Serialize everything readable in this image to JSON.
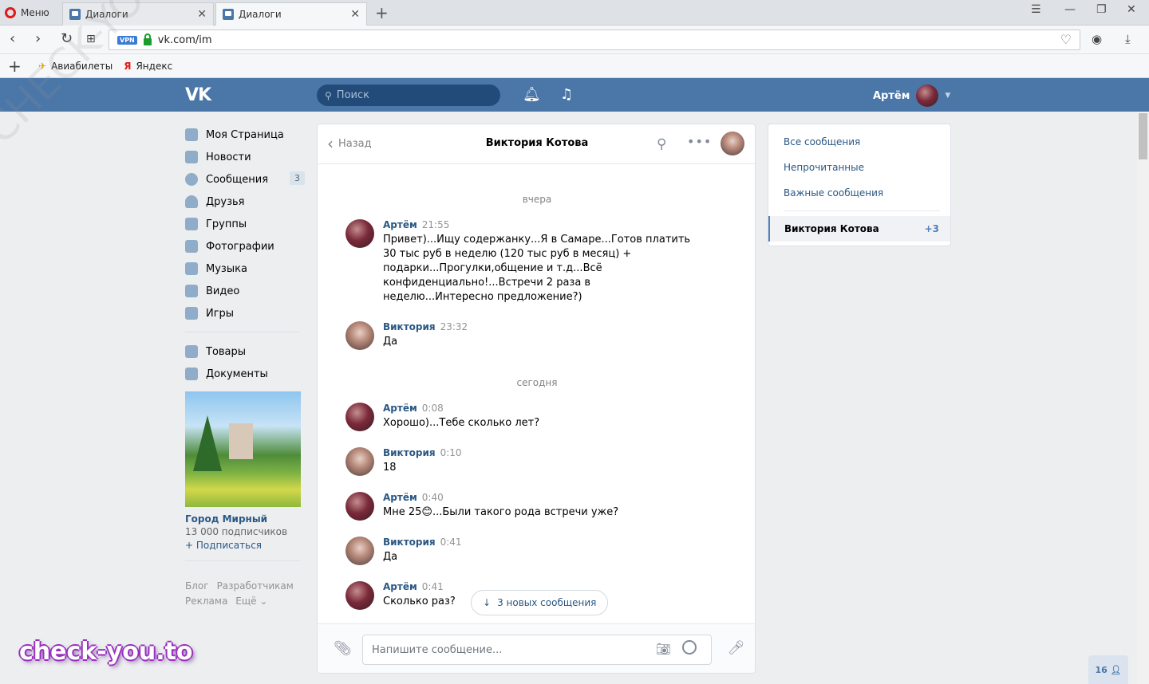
{
  "browser": {
    "menu_label": "Меню",
    "tabs": [
      {
        "title": "Диалоги"
      },
      {
        "title": "Диалоги"
      }
    ],
    "url": "vk.com/im",
    "vpn_label": "VPN",
    "bookmarks": [
      {
        "label": "Авиабилеты"
      },
      {
        "label": "Яндекс"
      }
    ]
  },
  "header": {
    "search_placeholder": "Поиск",
    "user_name": "Артём"
  },
  "nav": {
    "items": [
      {
        "label": "Моя Страница"
      },
      {
        "label": "Новости"
      },
      {
        "label": "Сообщения",
        "badge": "3"
      },
      {
        "label": "Друзья"
      },
      {
        "label": "Группы"
      },
      {
        "label": "Фотографии"
      },
      {
        "label": "Музыка"
      },
      {
        "label": "Видео"
      },
      {
        "label": "Игры"
      }
    ],
    "extra_items": [
      {
        "label": "Товары"
      },
      {
        "label": "Документы"
      }
    ],
    "group": {
      "name": "Город Мирный",
      "subscribers": "13 000 подписчиков",
      "subscribe": "+ Подписаться"
    },
    "footer": [
      "Блог",
      "Разработчикам",
      "Реклама",
      "Ещё ⌄"
    ]
  },
  "chat": {
    "back_label": "Назад",
    "title": "Виктория Котова",
    "days": [
      "вчера",
      "сегодня"
    ],
    "messages": [
      {
        "author": "Артём",
        "time": "21:55",
        "text": "Привет)...Ищу содержанку...Я в Самаре...Готов платить 30 тыс руб в неделю (120 тыс руб в месяц) + подарки...Прогулки,общение и т.д...Всё конфиденциально!...Встречи 2 раза в неделю...Интересно предложение?)"
      },
      {
        "author": "Виктория",
        "time": "23:32",
        "text": "Да"
      },
      {
        "author": "Артём",
        "time": "0:08",
        "text": "Хорошо)...Тебе сколько лет?"
      },
      {
        "author": "Виктория",
        "time": "0:10",
        "text": "18"
      },
      {
        "author": "Артём",
        "time": "0:40",
        "text": "Мне 25😊...Были такого рода встречи уже?"
      },
      {
        "author": "Виктория",
        "time": "0:41",
        "text": "Да"
      },
      {
        "author": "Артём",
        "time": "0:41",
        "text": "Сколько раз?"
      }
    ],
    "new_messages_label": "3 новых сообщения",
    "input_placeholder": "Напишите сообщение..."
  },
  "right_panel": {
    "filters": [
      "Все сообщения",
      "Непрочитанные",
      "Важные сообщения"
    ],
    "active_dialog": {
      "name": "Виктория Котова",
      "count": "+3"
    }
  },
  "online_count": "16",
  "watermark": "check-you.to",
  "watermark_diagonal": "CHECK-YOU.ME",
  "colors": {
    "vk_blue": "#4a76a8",
    "link": "#2a5885",
    "background": "#edeef0"
  }
}
